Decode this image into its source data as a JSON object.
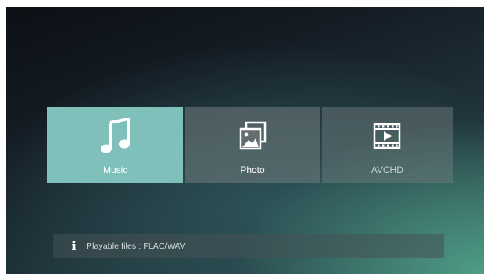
{
  "menu": {
    "items": [
      {
        "label": "Music",
        "icon": "music-note-icon",
        "selected": true
      },
      {
        "label": "Photo",
        "icon": "photo-stack-icon",
        "selected": false
      },
      {
        "label": "AVCHD",
        "icon": "video-film-icon",
        "selected": false
      }
    ]
  },
  "info_bar": {
    "icon": "info-icon",
    "glyph": "i",
    "text": "Playable files : FLAC/WAV"
  },
  "colors": {
    "selected_tile": "#7fc0bb",
    "unselected_tile": "#6e7a7c",
    "background_dark": "#0c1015",
    "background_teal": "#4f9d88"
  }
}
